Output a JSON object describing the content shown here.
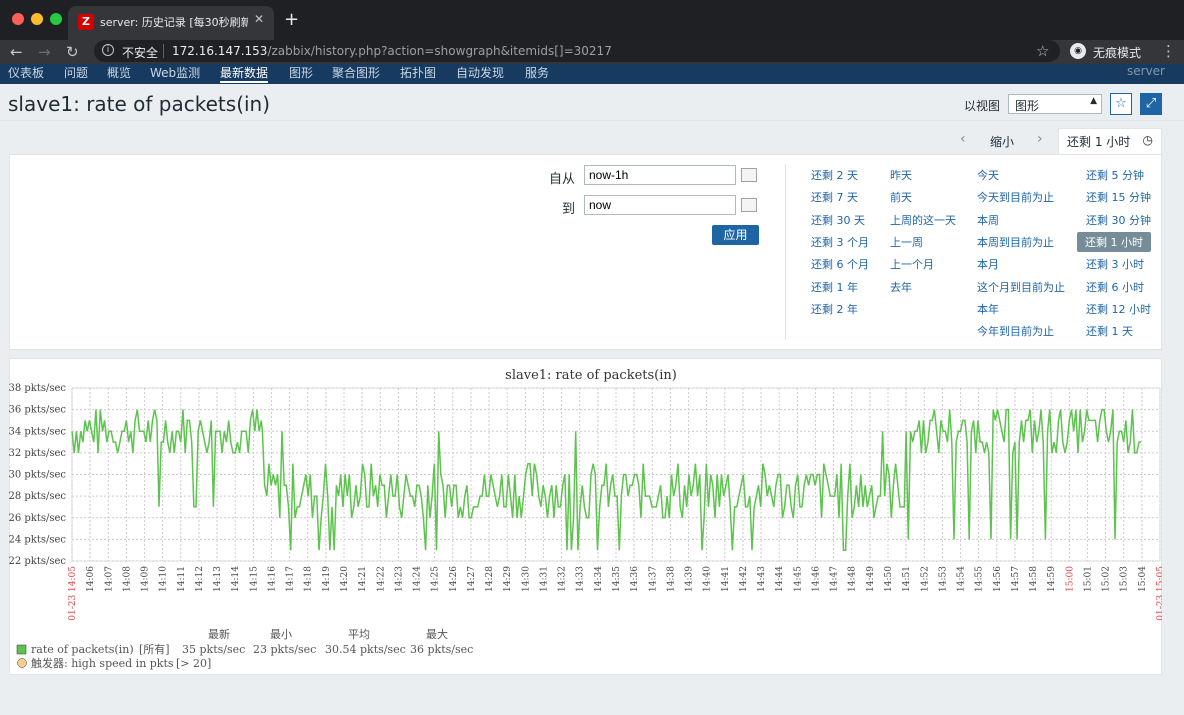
{
  "browser": {
    "tab_title": "server: 历史记录 [每30秒刷新一",
    "favicon": "Z",
    "insecure_label": "不安全",
    "url_host": "172.16.147.153",
    "url_path": "/zabbix/history.php?action=showgraph&itemids[]=30217",
    "incognito_label": "无痕模式"
  },
  "menu": {
    "items": [
      "仪表板",
      "问题",
      "概览",
      "Web监测",
      "最新数据",
      "图形",
      "聚合图形",
      "拓扑图",
      "自动发现",
      "服务"
    ],
    "active": "最新数据",
    "server": "server"
  },
  "page": {
    "title": "slave1: rate of packets(in)",
    "view_as_label": "以视图",
    "view_as_value": "图形"
  },
  "timebar": {
    "zoom_out": "缩小",
    "current": "还剩 1 小时",
    "from_label": "自从",
    "from_value": "now-1h",
    "to_label": "到",
    "to_value": "now",
    "apply": "应用",
    "col1": [
      "还剩 2 天",
      "还剩 7 天",
      "还剩 30 天",
      "还剩 3 个月",
      "还剩 6 个月",
      "还剩 1 年",
      "还剩 2 年"
    ],
    "col2": [
      "昨天",
      "前天",
      "上周的这一天",
      "上一周",
      "上一个月",
      "去年"
    ],
    "col3": [
      "今天",
      "今天到目前为止",
      "本周",
      "本周到目前为止",
      "本月",
      "这个月到目前为止",
      "本年",
      "今年到目前为止"
    ],
    "col4": [
      "还剩 5 分钟",
      "还剩 15 分钟",
      "还剩 30 分钟",
      "还剩 1 小时",
      "还剩 3 小时",
      "还剩 6 小时",
      "还剩 12 小时",
      "还剩 1 天"
    ],
    "selected": "还剩 1 小时"
  },
  "chart_data": {
    "type": "line",
    "title": "slave1: rate of packets(in)",
    "y_ticks": [
      "38 pkts/sec",
      "36 pkts/sec",
      "34 pkts/sec",
      "32 pkts/sec",
      "30 pkts/sec",
      "28 pkts/sec",
      "26 pkts/sec",
      "24 pkts/sec",
      "22 pkts/sec"
    ],
    "ylim": [
      22,
      38
    ],
    "x_start_label": "01-23 14:05",
    "x_end_label": "01-23 15:05",
    "x_ticks": [
      "14:06",
      "14:07",
      "14:08",
      "14:09",
      "14:10",
      "14:11",
      "14:12",
      "14:13",
      "14:14",
      "14:15",
      "14:16",
      "14:17",
      "14:18",
      "14:19",
      "14:20",
      "14:21",
      "14:22",
      "14:23",
      "14:24",
      "14:25",
      "14:26",
      "14:27",
      "14:28",
      "14:29",
      "14:30",
      "14:31",
      "14:32",
      "14:33",
      "14:34",
      "14:35",
      "14:36",
      "14:37",
      "14:38",
      "14:39",
      "14:40",
      "14:41",
      "14:42",
      "14:43",
      "14:44",
      "14:45",
      "14:46",
      "14:47",
      "14:48",
      "14:49",
      "14:50",
      "14:51",
      "14:52",
      "14:53",
      "14:54",
      "14:55",
      "14:56",
      "14:57",
      "14:58",
      "14:59",
      "15:00",
      "15:01",
      "15:02",
      "15:03",
      "15:04"
    ],
    "x_highlight": "15:00",
    "series_color": "#5dc34e",
    "segments": [
      {
        "from_min": 0,
        "to_min": 10.5,
        "low": 32,
        "high": 36,
        "spike_min": 27
      },
      {
        "from_min": 10.5,
        "to_min": 46,
        "low": 26,
        "high": 31,
        "spike_min": 23,
        "spike_max": 34
      },
      {
        "from_min": 46,
        "to_min": 59,
        "low": 32,
        "high": 36,
        "spike_min": 24
      }
    ],
    "legend": {
      "headers": [
        "最新",
        "最小",
        "平均",
        "最大"
      ],
      "series_name": "rate of packets(in)",
      "scope": "[所有]",
      "values": [
        "35 pkts/sec",
        "23 pkts/sec",
        "30.54 pkts/sec",
        "36 pkts/sec"
      ],
      "trigger_label": "触发器: high speed in pkts",
      "trigger_value": "[> 20]",
      "trigger_color": "#f6cf8c"
    }
  }
}
